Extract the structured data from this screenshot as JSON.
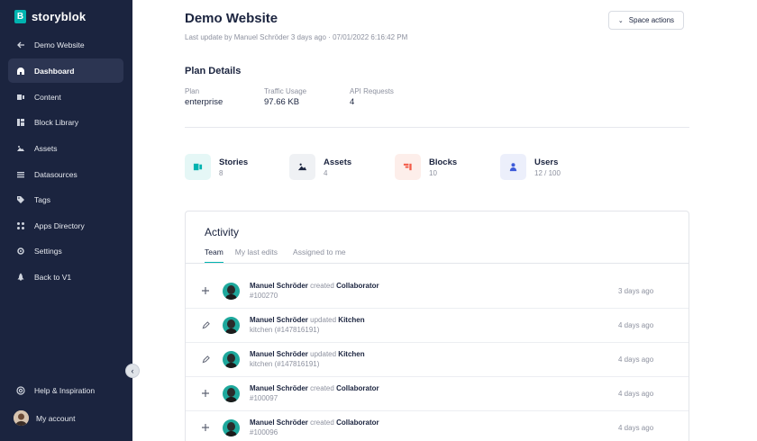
{
  "brand": {
    "name": "storyblok",
    "mark": "B"
  },
  "sidebar": {
    "back_label": "Demo Website",
    "items": [
      {
        "label": "Dashboard",
        "icon": "dashboard-icon",
        "active": true
      },
      {
        "label": "Content",
        "icon": "content-icon"
      },
      {
        "label": "Block Library",
        "icon": "block-library-icon"
      },
      {
        "label": "Assets",
        "icon": "assets-icon"
      },
      {
        "label": "Datasources",
        "icon": "datasources-icon"
      },
      {
        "label": "Tags",
        "icon": "tags-icon"
      },
      {
        "label": "Apps Directory",
        "icon": "apps-icon"
      },
      {
        "label": "Settings",
        "icon": "gear-icon"
      },
      {
        "label": "Back to V1",
        "icon": "rocket-icon"
      }
    ],
    "help_label": "Help & Inspiration",
    "account_label": "My account"
  },
  "header": {
    "title": "Demo Website",
    "subtitle": "Last update by Manuel Schröder 3 days ago · 07/01/2022 6:16:42 PM",
    "space_actions_label": "Space actions"
  },
  "plan": {
    "title": "Plan Details",
    "columns": [
      {
        "label": "Plan",
        "value": "enterprise"
      },
      {
        "label": "Traffic Usage",
        "value": "97.66 KB"
      },
      {
        "label": "API Requests",
        "value": "4"
      }
    ]
  },
  "stats": [
    {
      "name": "Stories",
      "count": "8",
      "icon": "stories-icon",
      "color": "#00b3b0",
      "bg": "#e5f7f6"
    },
    {
      "name": "Assets",
      "count": "4",
      "icon": "assets-icon",
      "color": "#1b243f",
      "bg": "#eff1f4"
    },
    {
      "name": "Blocks",
      "count": "10",
      "icon": "blocks-icon",
      "color": "#f35b48",
      "bg": "#fdeeea"
    },
    {
      "name": "Users",
      "count": "12 / 100",
      "icon": "users-icon",
      "color": "#3d5bd9",
      "bg": "#eceffb"
    }
  ],
  "activity": {
    "title": "Activity",
    "tabs": [
      "Team",
      "My last edits",
      "Assigned to me"
    ],
    "rows": [
      {
        "icon": "plus-icon",
        "who": "Manuel Schröder",
        "verb": "created",
        "what": "Collaborator",
        "detail": "#100270",
        "time": "3 days ago"
      },
      {
        "icon": "pencil-icon",
        "who": "Manuel Schröder",
        "verb": "updated",
        "what": "Kitchen",
        "detail": "kitchen (#147816191)",
        "time": "4 days ago"
      },
      {
        "icon": "pencil-icon",
        "who": "Manuel Schröder",
        "verb": "updated",
        "what": "Kitchen",
        "detail": "kitchen (#147816191)",
        "time": "4 days ago"
      },
      {
        "icon": "plus-icon",
        "who": "Manuel Schröder",
        "verb": "created",
        "what": "Collaborator",
        "detail": "#100097",
        "time": "4 days ago"
      },
      {
        "icon": "plus-icon",
        "who": "Manuel Schröder",
        "verb": "created",
        "what": "Collaborator",
        "detail": "#100096",
        "time": "4 days ago"
      }
    ]
  }
}
